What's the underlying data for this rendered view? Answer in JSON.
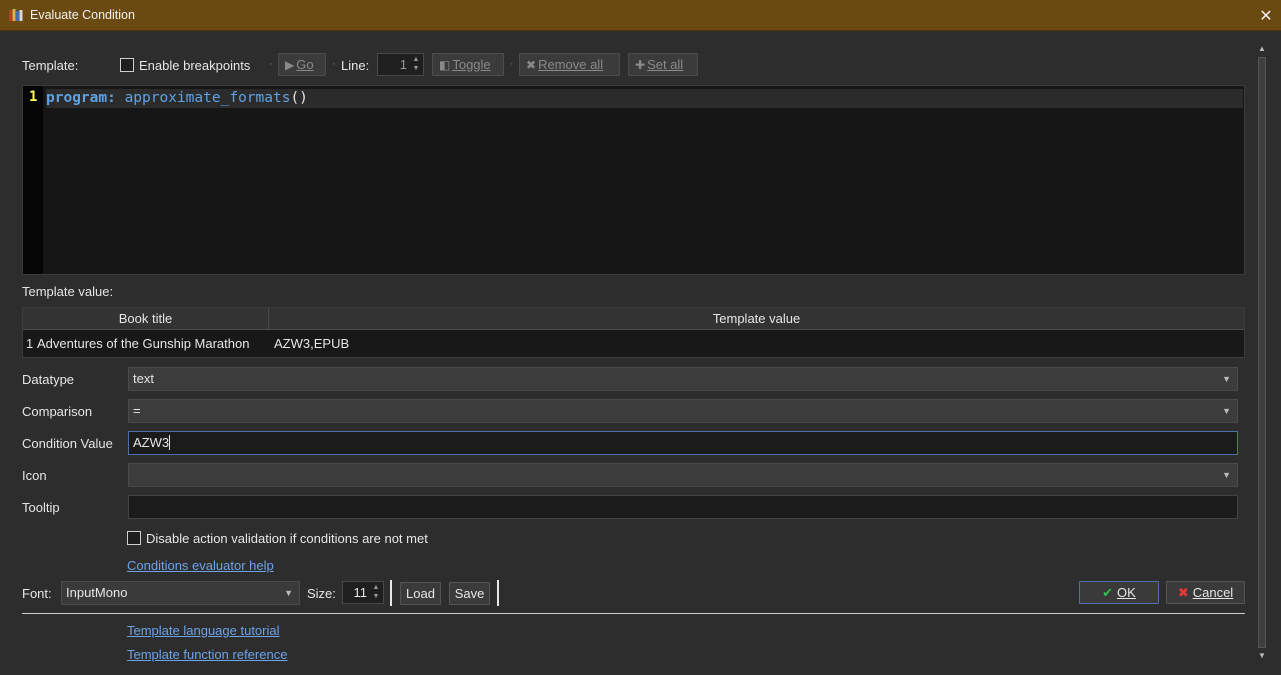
{
  "window": {
    "title": "Evaluate Condition",
    "close_glyph": "✕"
  },
  "toolbar": {
    "template_label": "Template:",
    "enable_breakpoints": "Enable breakpoints",
    "go": "Go",
    "line_label": "Line:",
    "line_value": "1",
    "toggle": "Toggle",
    "remove_all": "Remove all",
    "set_all": "Set all",
    "dot": "·"
  },
  "editor": {
    "line_number": "1",
    "keyword": "program:",
    "function": "approximate_formats",
    "parens": "()"
  },
  "results": {
    "label": "Template value:",
    "columns": [
      "Book title",
      "Template value"
    ],
    "rows": [
      {
        "index": "1",
        "book_title": "Adventures of the Gunship Marathon",
        "value": "AZW3,EPUB"
      }
    ]
  },
  "form": {
    "datatype_label": "Datatype",
    "datatype_value": "text",
    "comparison_label": "Comparison",
    "comparison_value": "=",
    "condition_value_label": "Condition Value",
    "condition_value": "AZW3",
    "icon_label": "Icon",
    "icon_value": "",
    "tooltip_label": "Tooltip",
    "tooltip_value": "",
    "disable_validation": "Disable action validation if conditions are not met",
    "help_link": "Conditions evaluator help"
  },
  "footer": {
    "font_label": "Font:",
    "font_value": "InputMono",
    "size_label": "Size:",
    "size_value": "11",
    "load": "Load",
    "save": "Save",
    "ok": "OK",
    "cancel": "Cancel",
    "tutorial_link": "Template language tutorial",
    "reference_link": "Template function reference"
  },
  "colors": {
    "titlebar": "#6b4a12",
    "link": "#6ea3e8",
    "keyword": "#5fa2e4",
    "line_number": "#ffff55",
    "ok_check": "#2fbf4a",
    "cancel_x": "#e03a3a"
  }
}
